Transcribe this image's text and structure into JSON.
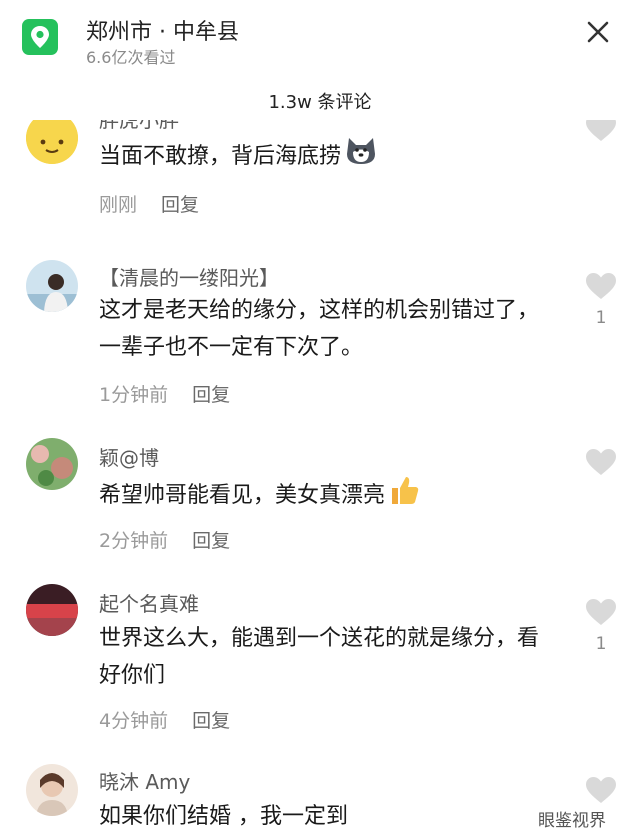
{
  "header": {
    "location": "郑州市 · 中牟县",
    "views": "6.6亿次看过"
  },
  "comment_count": "1.3w 条评论",
  "comments": [
    {
      "name": "胖虎小胖",
      "text": "当面不敢撩，背后海底捞",
      "time": "刚刚",
      "reply": "回复",
      "likes": ""
    },
    {
      "name": "【清晨的一缕阳光】",
      "text": "这才是老天给的缘分，这样的机会别错过了，一辈子也不一定有下次了。",
      "time": "1分钟前",
      "reply": "回复",
      "likes": "1"
    },
    {
      "name": "颖@博",
      "text": "希望帅哥能看见，美女真漂亮",
      "time": "2分钟前",
      "reply": "回复",
      "likes": ""
    },
    {
      "name": "起个名真难",
      "text": "世界这么大，能遇到一个送花的就是缘分，看好你们",
      "time": "4分钟前",
      "reply": "回复",
      "likes": "1"
    },
    {
      "name": "晓沐 Amy",
      "text": "如果你们结婚 ，我一定到",
      "time": "",
      "reply": "",
      "likes": ""
    }
  ],
  "watermark": "眼鉴视界",
  "colors": {
    "location_icon": "#25c15c",
    "like_icon": "#d9d9d9",
    "secondary_text": "#9a9a9a"
  }
}
